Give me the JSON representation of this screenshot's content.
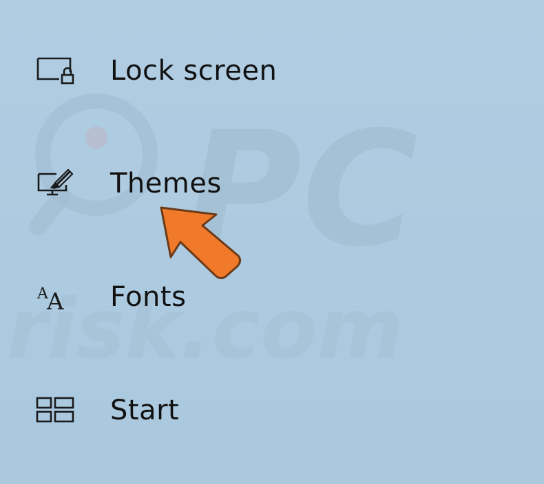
{
  "nav": {
    "items": [
      {
        "label": "Lock screen",
        "icon": "lock-screen-icon"
      },
      {
        "label": "Themes",
        "icon": "themes-icon"
      },
      {
        "label": "Fonts",
        "icon": "fonts-icon"
      },
      {
        "label": "Start",
        "icon": "start-icon"
      }
    ]
  },
  "fonts_icon": {
    "glyph_small": "A",
    "glyph_large": "A"
  },
  "colors": {
    "background": "#aecbe0",
    "text": "#111111",
    "icon": "#1a1a1a",
    "arrow": "#f07a2a",
    "arrow_outline": "#6b3a18",
    "watermark": "#9fbcd2"
  },
  "watermark": {
    "big": "PC",
    "small": "risk.com"
  }
}
